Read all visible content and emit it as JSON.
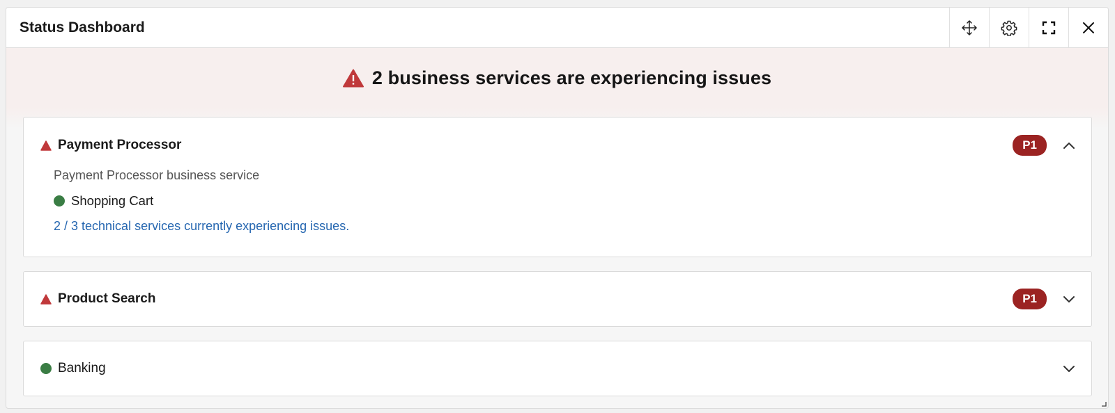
{
  "window": {
    "title": "Status Dashboard"
  },
  "toolbar": {
    "move_icon": "move-icon",
    "settings_icon": "gear-icon",
    "fullscreen_icon": "fullscreen-icon",
    "close_icon": "close-icon"
  },
  "banner": {
    "message": "2 business services are experiencing issues",
    "icon": "warning-triangle-icon"
  },
  "services": [
    {
      "name": "Payment Processor",
      "status": "issue",
      "priority": "P1",
      "expanded": true,
      "description": "Payment Processor business service",
      "children": [
        {
          "name": "Shopping Cart",
          "status": "ok"
        }
      ],
      "summary_link": "2 / 3 technical services currently experiencing issues."
    },
    {
      "name": "Product Search",
      "status": "issue",
      "priority": "P1",
      "expanded": false
    },
    {
      "name": "Banking",
      "status": "ok",
      "expanded": false
    }
  ],
  "colors": {
    "issue": "#c0393b",
    "ok": "#3a7d44",
    "badge": "#9b2322",
    "link": "#2566b0",
    "banner_bg": "#f7efee"
  }
}
